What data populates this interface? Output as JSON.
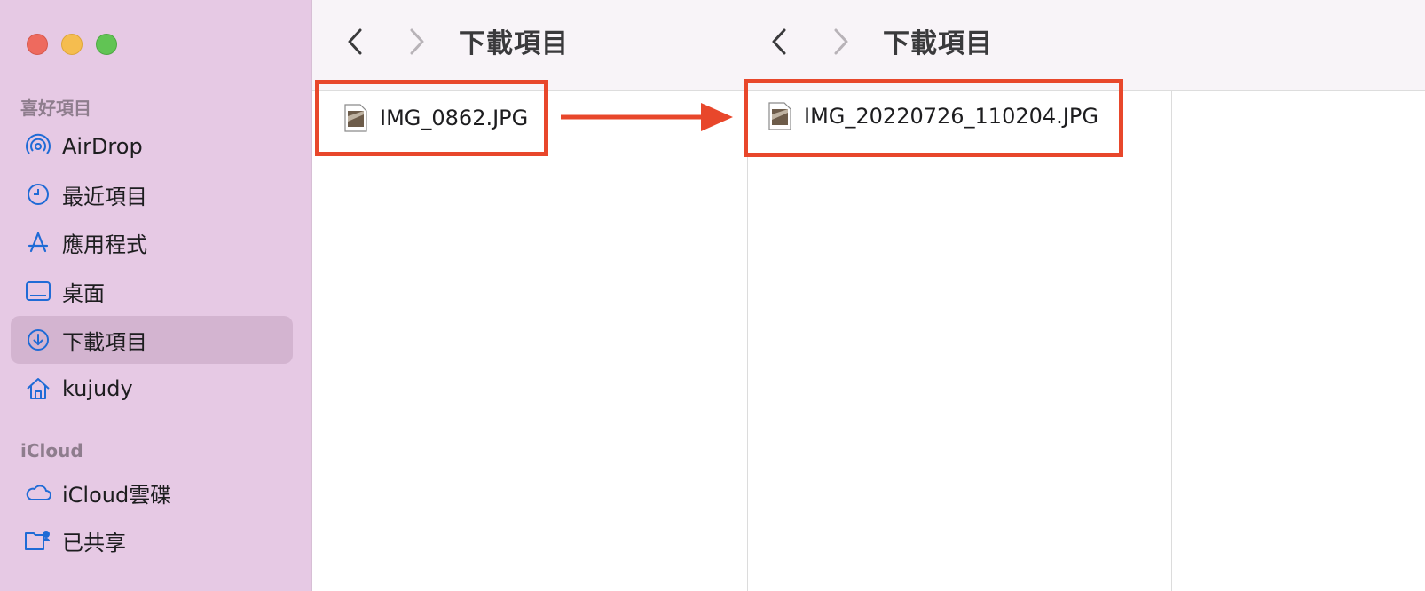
{
  "sidebar": {
    "favorites_header": "喜好項目",
    "favorites": [
      {
        "label": "AirDrop",
        "icon": "airdrop-icon"
      },
      {
        "label": "最近項目",
        "icon": "clock-icon"
      },
      {
        "label": "應用程式",
        "icon": "applications-icon"
      },
      {
        "label": "桌面",
        "icon": "desktop-icon"
      },
      {
        "label": "下載項目",
        "icon": "download-icon",
        "selected": true
      },
      {
        "label": "kujudy",
        "icon": "home-icon"
      }
    ],
    "icloud_header": "iCloud",
    "icloud": [
      {
        "label": "iCloud雲碟",
        "icon": "cloud-icon"
      },
      {
        "label": "已共享",
        "icon": "shared-folder-icon"
      }
    ]
  },
  "panes": [
    {
      "title": "下載項目",
      "file": "IMG_0862.JPG"
    },
    {
      "title": "下載項目",
      "file": "IMG_20220726_110204.JPG"
    }
  ],
  "colors": {
    "sidebar_bg": "#e6c9e4",
    "selected_bg": "#d3b4d0",
    "accent_icon": "#1f6bd6",
    "highlight": "#e8472b"
  }
}
